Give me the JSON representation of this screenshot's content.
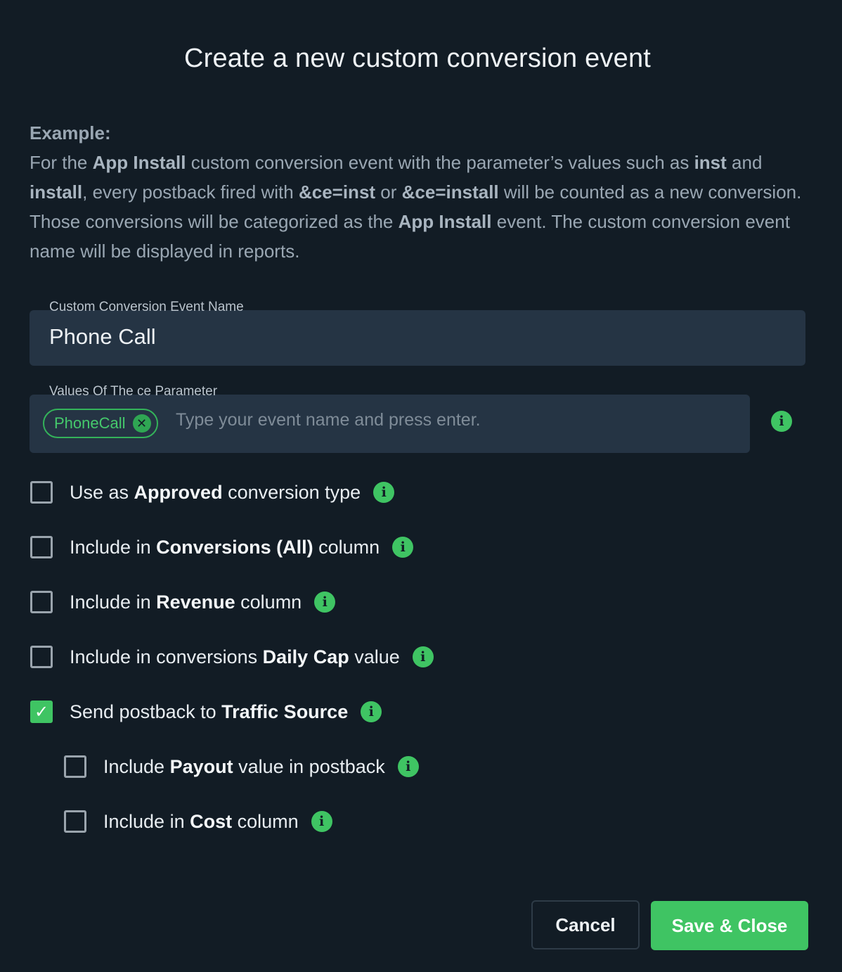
{
  "dialog": {
    "title": "Create a new custom conversion event"
  },
  "example": {
    "heading": "Example:",
    "p1": "For the ",
    "b1": "App Install",
    "p2": " custom conversion event with the parameter’s values such as ",
    "b2": "inst",
    "p3": " and ",
    "b3": "install",
    "p4": ", every postback fired with ",
    "b4": "&ce=inst",
    "p5": " or ",
    "b5": "&ce=install",
    "p6": " will be counted as a new conversion. Those conversions will be categorized as the ",
    "b6": "App Install",
    "p7": " event. The custom conversion event name will be displayed in reports."
  },
  "name_field": {
    "label": "Custom Conversion Event Name",
    "value": "Phone Call"
  },
  "values_field": {
    "label": "Values Of The ce Parameter",
    "chip": "PhoneCall",
    "chip_remove_glyph": "✕",
    "placeholder": "Type your event name and press enter."
  },
  "info_glyph": "i",
  "check_glyph": "✓",
  "options": [
    {
      "pre": "Use as ",
      "bold": "Approved",
      "post": " conversion type",
      "checked": false
    },
    {
      "pre": "Include in ",
      "bold": "Conversions (All)",
      "post": " column",
      "checked": false
    },
    {
      "pre": "Include in ",
      "bold": "Revenue",
      "post": " column",
      "checked": false
    },
    {
      "pre": "Include in conversions ",
      "bold": "Daily Cap",
      "post": " value",
      "checked": false
    },
    {
      "pre": "Send postback to ",
      "bold": "Traffic Source",
      "post": "",
      "checked": true
    },
    {
      "pre": "Include ",
      "bold": "Payout",
      "post": " value in postback",
      "checked": false
    },
    {
      "pre": "Include in ",
      "bold": "Cost",
      "post": " column",
      "checked": false
    }
  ],
  "buttons": {
    "cancel": "Cancel",
    "save": "Save & Close"
  },
  "colors": {
    "background": "#121c25",
    "field": "#253444",
    "accent": "#3fc463"
  }
}
